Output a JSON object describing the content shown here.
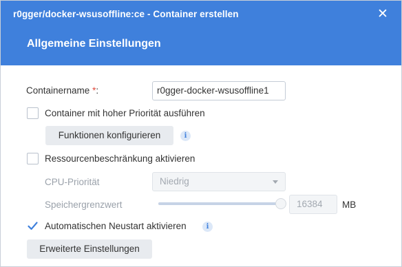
{
  "dialog": {
    "window_title": "r0gger/docker-wsusoffline:ce - Container erstellen",
    "close_glyph": "✕",
    "section_title": "Allgemeine Einstellungen"
  },
  "form": {
    "container_name": {
      "label": "Containername",
      "required_mark": "*",
      "label_suffix": ":",
      "value": "r0gger-docker-wsusoffline1"
    },
    "high_priority": {
      "label": "Container mit hoher Priorität ausführen",
      "checked": false
    },
    "configure_functions_button": "Funktionen konfigurieren",
    "resource_limit": {
      "label": "Ressourcenbeschränkung aktivieren",
      "checked": false
    },
    "cpu_priority": {
      "label": "CPU-Priorität",
      "selected": "Niedrig"
    },
    "memory_limit": {
      "label": "Speichergrenzwert",
      "value": "16384",
      "unit": "MB",
      "slider_fraction": 1.0
    },
    "auto_restart": {
      "label": "Automatischen Neustart aktivieren",
      "checked": true
    },
    "advanced_settings_button": "Erweiterte Einstellungen"
  },
  "icons": {
    "close": "close-icon",
    "info": "info-icon",
    "check": "check-icon",
    "dropdown": "chevron-down-icon"
  },
  "colors": {
    "header": "#3f80dc",
    "required": "#e0493c",
    "check": "#3f80dc"
  }
}
